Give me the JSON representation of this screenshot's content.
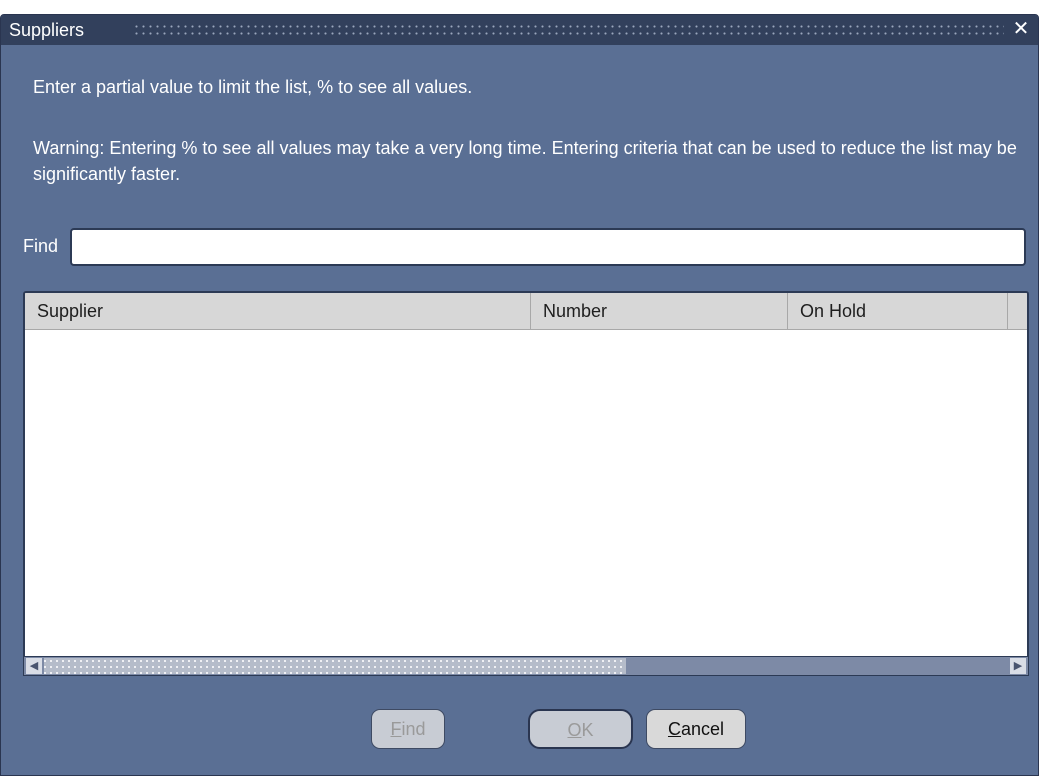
{
  "window": {
    "title": "Suppliers",
    "close_glyph": "✕"
  },
  "messages": {
    "hint": "Enter a partial value to limit the list, % to see all values.",
    "warning": "Warning: Entering % to see all values may take a very long time. Entering criteria that can be used to reduce the list may be significantly faster."
  },
  "find": {
    "label": "Find",
    "value": "",
    "placeholder": ""
  },
  "table": {
    "columns": [
      "Supplier",
      "Number",
      "On Hold",
      ""
    ],
    "rows": []
  },
  "scrollbar": {
    "left_glyph": "◀",
    "right_glyph": "▶"
  },
  "buttons": {
    "find": {
      "mnemonic": "F",
      "rest": "ind",
      "enabled": false
    },
    "ok": {
      "mnemonic": "O",
      "rest": "K",
      "enabled": false
    },
    "cancel": {
      "mnemonic": "C",
      "rest": "ancel",
      "enabled": true
    }
  },
  "colors": {
    "window_bg": "#5a6f94",
    "titlebar_bg": "#32405c",
    "header_bg": "#d7d7d7"
  }
}
